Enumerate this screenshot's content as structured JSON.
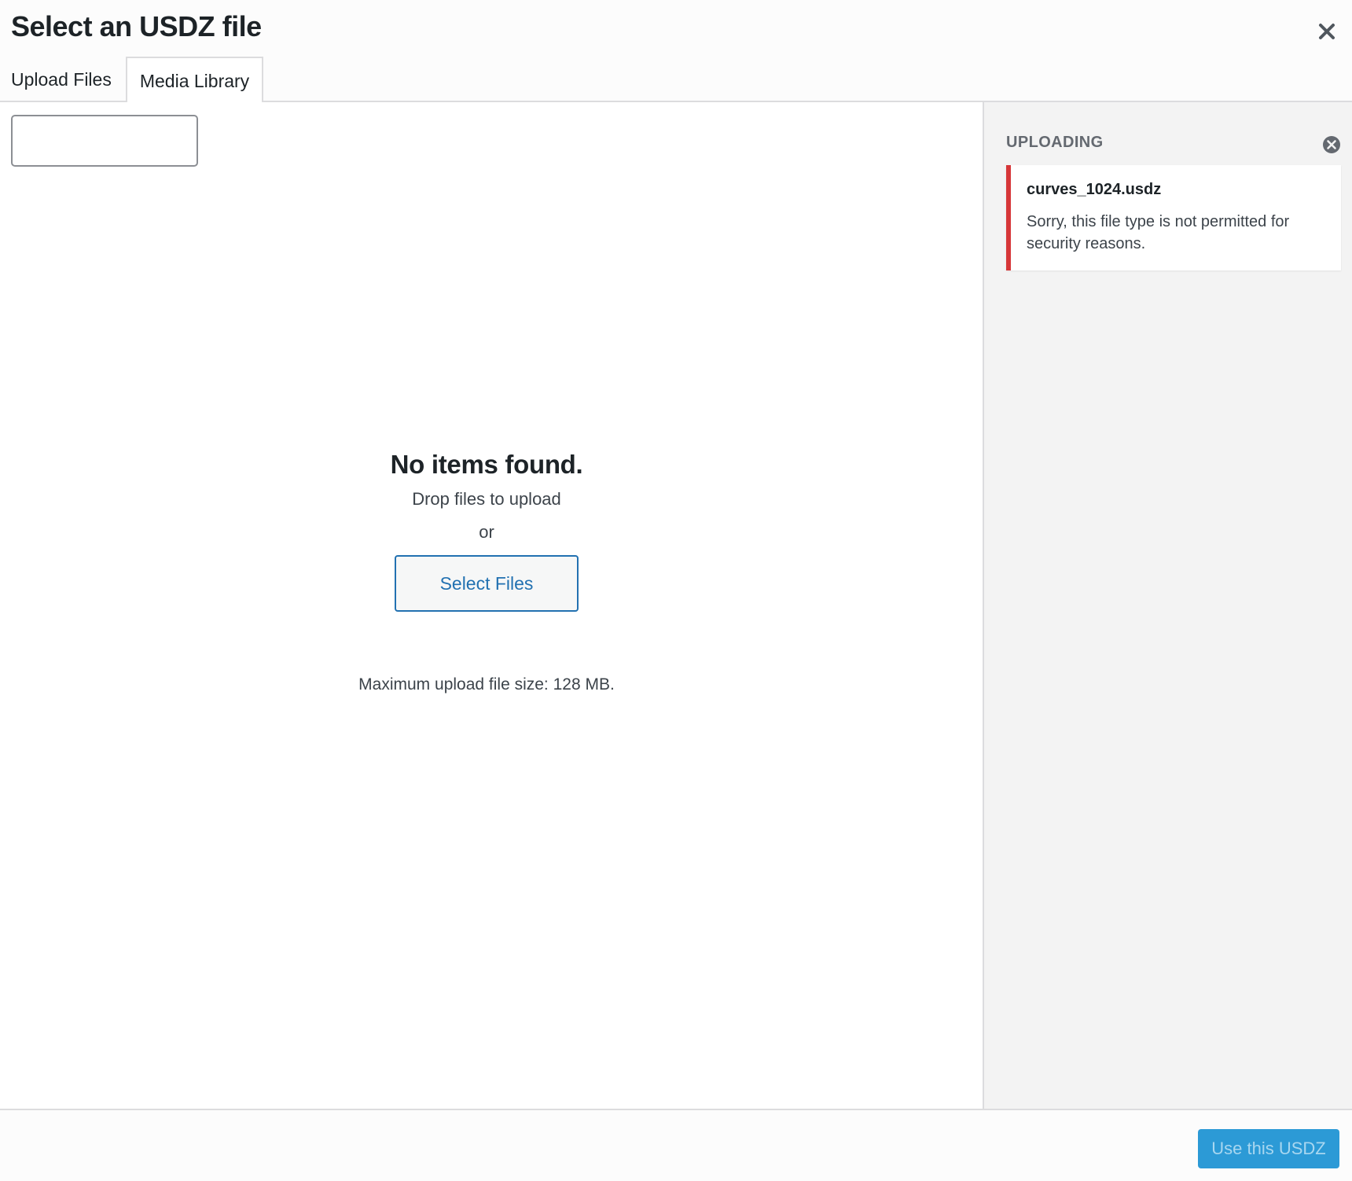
{
  "header": {
    "title": "Select an USDZ file",
    "close_icon": "close-icon"
  },
  "tabs": [
    {
      "label": "Upload Files",
      "active": false
    },
    {
      "label": "Media Library",
      "active": true
    }
  ],
  "search": {
    "value": "",
    "placeholder": ""
  },
  "empty_state": {
    "title": "No items found.",
    "drop_text": "Drop files to upload",
    "or_text": "or",
    "select_button": "Select Files",
    "max_size": "Maximum upload file size: 128 MB."
  },
  "sidebar": {
    "heading": "UPLOADING",
    "dismiss_icon": "dismiss-circle-icon",
    "errors": [
      {
        "filename": "curves_1024.usdz",
        "message": "Sorry, this file type is not permitted for security reasons."
      }
    ]
  },
  "footer": {
    "use_button": "Use this USDZ"
  },
  "colors": {
    "accent": "#2271b1",
    "error": "#d63638",
    "primary_button": "#2c9ad6"
  }
}
